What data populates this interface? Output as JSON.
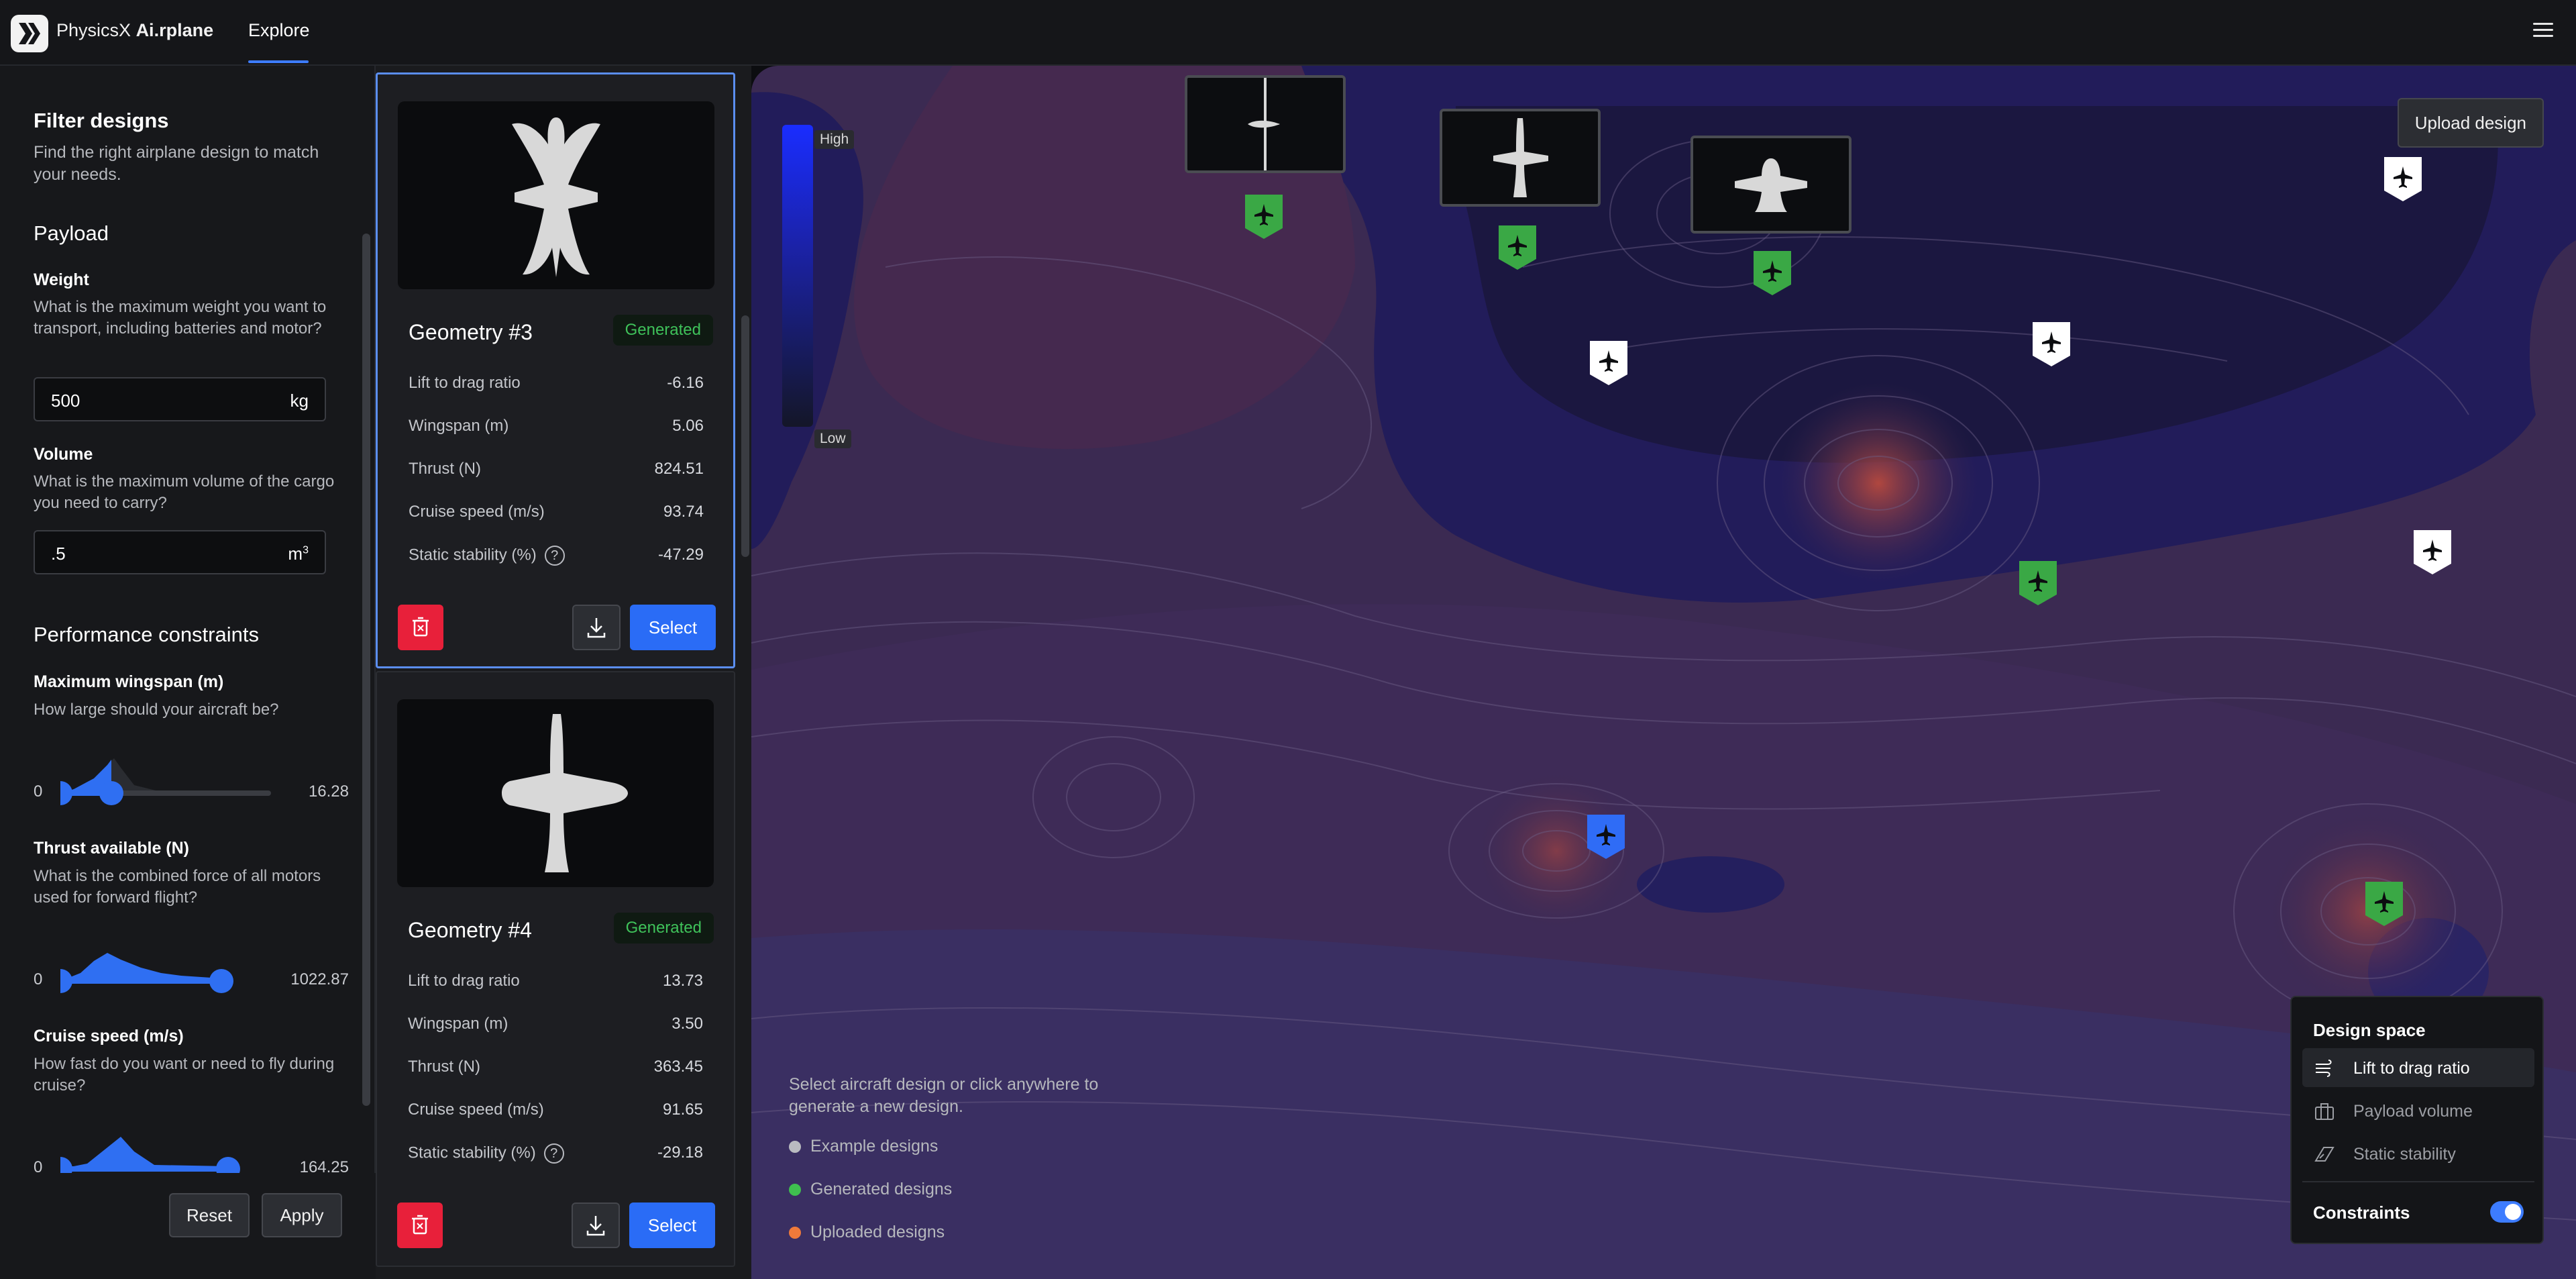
{
  "app": {
    "brand_prefix": "PhysicsX",
    "brand_name": "Ai.rplane",
    "nav_tab": "Explore"
  },
  "filter": {
    "title": "Filter designs",
    "subtitle": "Find the right airplane design to match your needs.",
    "payload_title": "Payload",
    "weight_label": "Weight",
    "weight_help": "What is the maximum weight you want to transport, including batteries and motor?",
    "weight_value": "500",
    "weight_unit": "kg",
    "volume_label": "Volume",
    "volume_help": "What is the maximum volume of the cargo you need to carry?",
    "volume_value": ".5",
    "volume_unit": "m",
    "volume_unit_sup": "3",
    "perf_title": "Performance constraints",
    "wingspan_label": "Maximum wingspan (m)",
    "wingspan_help": "How large should your aircraft be?",
    "wingspan_min": "0",
    "wingspan_max": "16.28",
    "wingspan_handles": [
      0.0,
      0.24
    ],
    "thrust_label": "Thrust available (N)",
    "thrust_help": "What is the combined force of all motors used for forward flight?",
    "thrust_min": "0",
    "thrust_max": "1022.87",
    "thrust_handles": [
      0.0,
      0.82
    ],
    "cruise_label": "Cruise speed (m/s)",
    "cruise_help": "How fast do you want or need to fly during cruise?",
    "cruise_min": "0",
    "cruise_max": "164.25",
    "reset_label": "Reset",
    "apply_label": "Apply"
  },
  "cards": [
    {
      "title": "Geometry #3",
      "badge": "Generated",
      "metrics": [
        {
          "label": "Lift to drag ratio",
          "value": "-6.16"
        },
        {
          "label": "Wingspan (m)",
          "value": "5.06"
        },
        {
          "label": "Thrust (N)",
          "value": "824.51"
        },
        {
          "label": "Cruise speed (m/s)",
          "value": "93.74"
        },
        {
          "label": "Static stability (%)",
          "value": "-47.29"
        }
      ],
      "select_label": "Select"
    },
    {
      "title": "Geometry #4",
      "badge": "Generated",
      "metrics": [
        {
          "label": "Lift to drag ratio",
          "value": "13.73"
        },
        {
          "label": "Wingspan (m)",
          "value": "3.50"
        },
        {
          "label": "Thrust (N)",
          "value": "363.45"
        },
        {
          "label": "Cruise speed (m/s)",
          "value": "91.65"
        },
        {
          "label": "Static stability (%)",
          "value": "-29.18"
        }
      ],
      "select_label": "Select"
    }
  ],
  "map": {
    "scale_high": "High",
    "scale_low": "Low",
    "upload_label": "Upload design",
    "hint": "Select aircraft design or click anywhere to generate a new design.",
    "legend": [
      {
        "label": "Example designs",
        "color": "#b9bbc0"
      },
      {
        "label": "Generated designs",
        "color": "#3fbf4f"
      },
      {
        "label": "Uploaded designs",
        "color": "#f07a3a"
      }
    ],
    "pin_colors": {
      "generated": "#3aa845",
      "example": "#ffffff",
      "selected": "#2f6cf6"
    }
  },
  "design_space": {
    "title": "Design space",
    "items": [
      {
        "label": "Lift to drag ratio",
        "icon": "wind-icon",
        "active": true
      },
      {
        "label": "Payload volume",
        "icon": "briefcase-icon",
        "active": false
      },
      {
        "label": "Static stability",
        "icon": "stability-icon",
        "active": false
      }
    ],
    "constraints_label": "Constraints",
    "constraints_on": true
  }
}
